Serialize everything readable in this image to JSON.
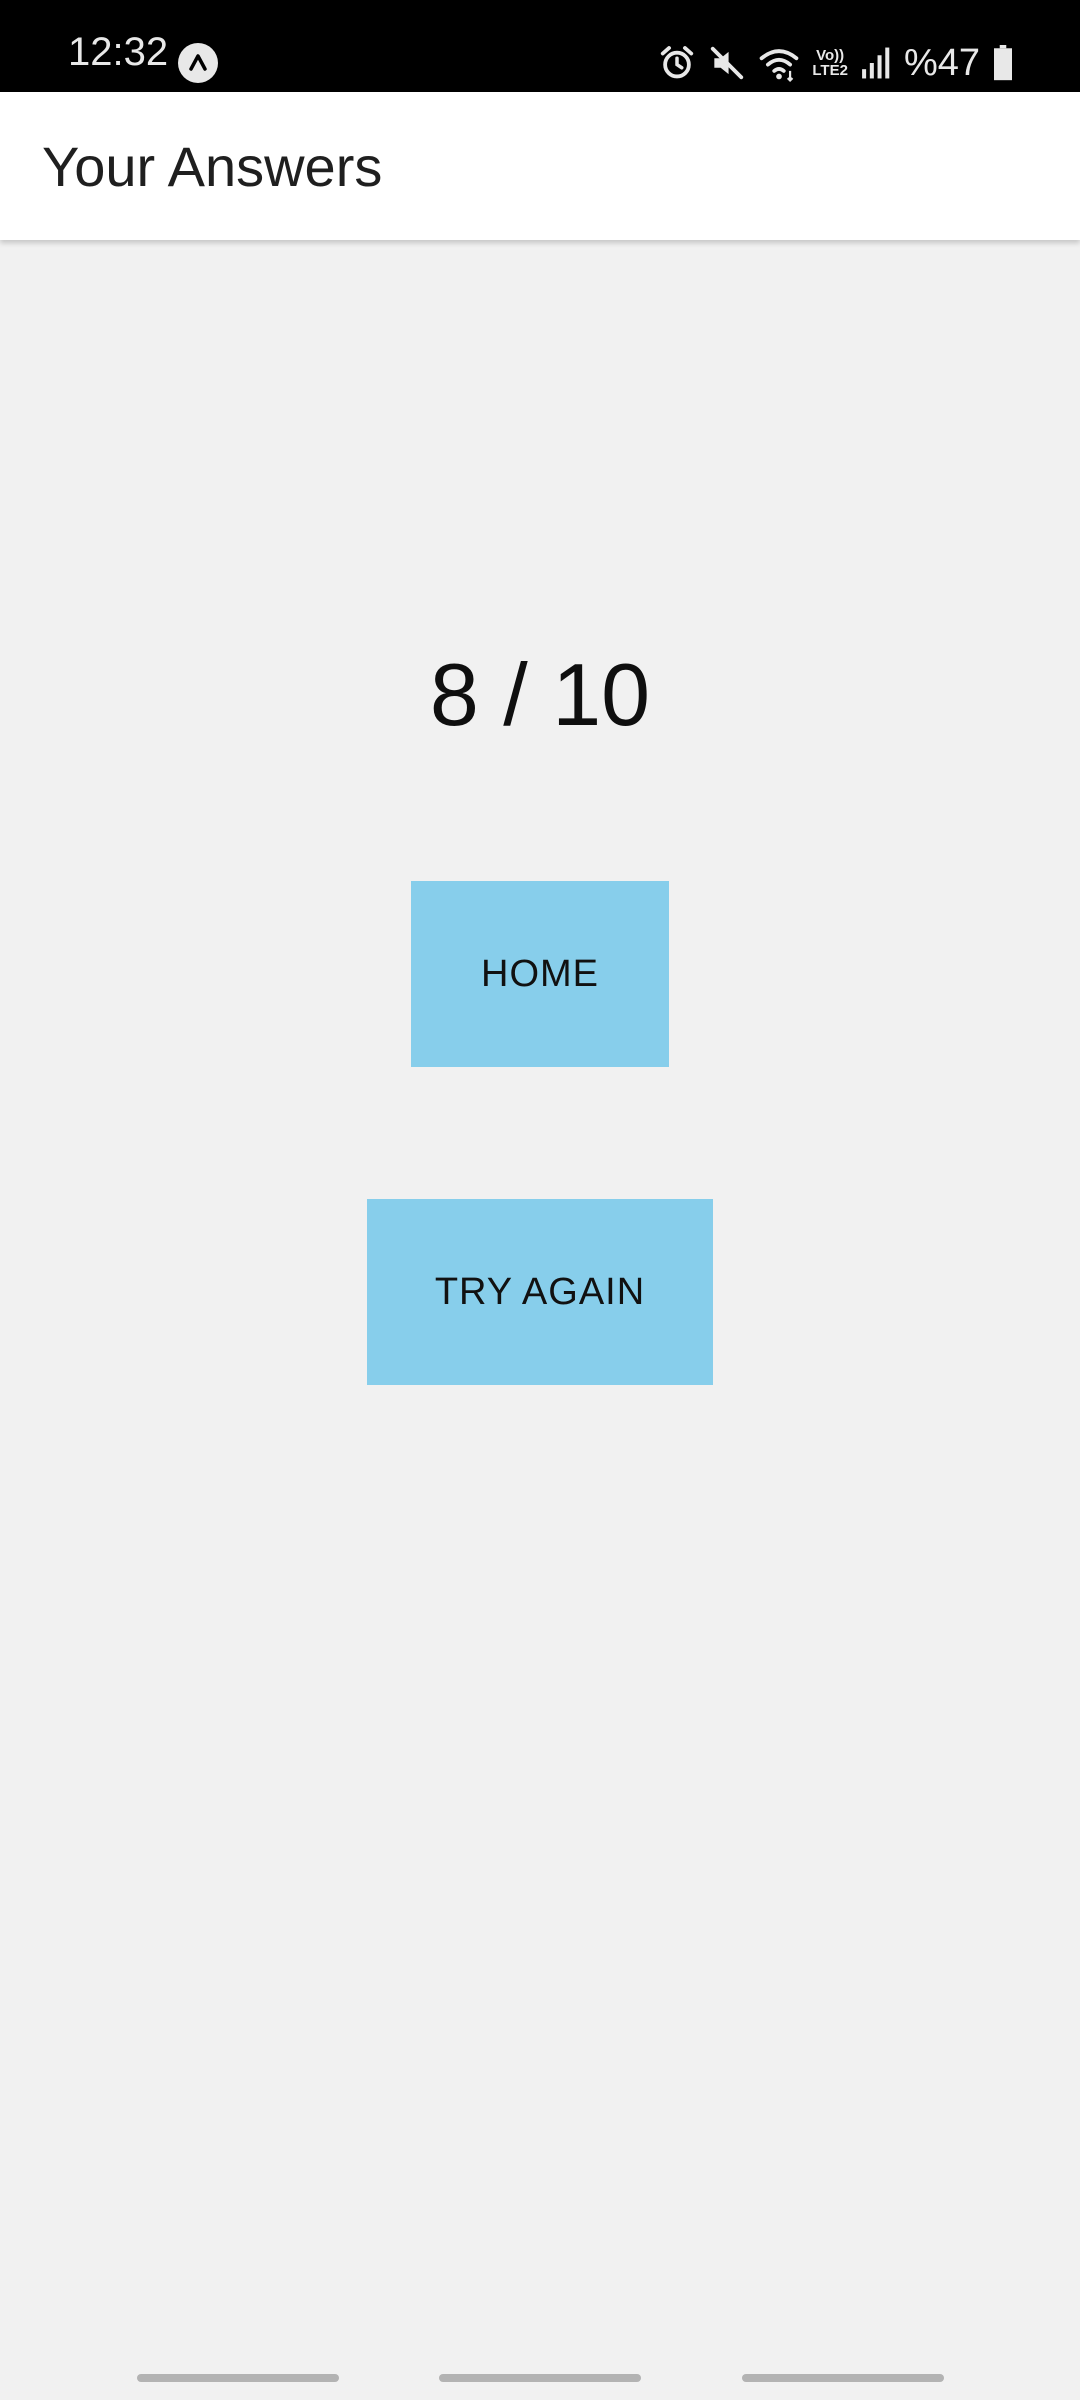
{
  "status_bar": {
    "time": "12:32",
    "lte_top": "Vo))",
    "lte_bottom": "LTE2",
    "battery": "%47",
    "icons": [
      "app-notification-icon",
      "alarm-icon",
      "mute-icon",
      "wifi-icon",
      "volte-icon",
      "signal-icon",
      "battery-icon"
    ]
  },
  "app_bar": {
    "title": "Your Answers"
  },
  "result": {
    "score": "8 / 10"
  },
  "buttons": {
    "home": "HOME",
    "try_again": "TRY AGAIN"
  },
  "colors": {
    "button_bg": "#87ceeb",
    "page_bg": "#f1f1f1",
    "status_bar_bg": "#000000"
  }
}
